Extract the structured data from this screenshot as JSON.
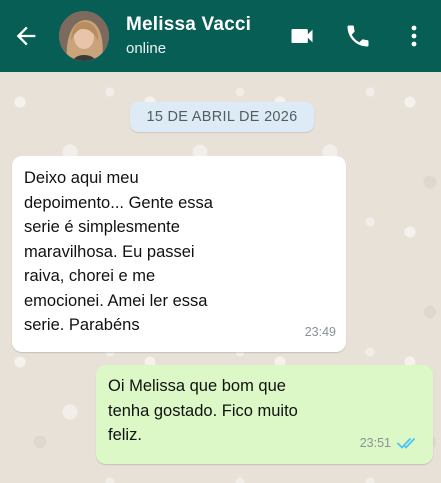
{
  "header": {
    "contact_name": "Melissa Vacci",
    "status": "online",
    "icons": [
      "back-arrow-icon",
      "video-call-icon",
      "phone-icon",
      "more-options-icon"
    ]
  },
  "chat": {
    "date_chip": "15 DE ABRIL DE 2026",
    "messages": [
      {
        "direction": "incoming",
        "text": "Deixo aqui meu\ndepoimento... Gente essa\nserie é simplesmente\nmaravilhosa. Eu passei\nraiva, chorei e me\nemocionei. Amei ler essa\nserie. Parabéns",
        "time": "23:49"
      },
      {
        "direction": "outgoing",
        "text": "Oi Melissa que bom que\ntenha gostado. Fico muito\nfeliz.",
        "time": "23:51",
        "read": true
      }
    ]
  },
  "colors": {
    "header_bg": "#075e54",
    "incoming_bg": "#ffffff",
    "outgoing_bg": "#dcf8c6",
    "read_ticks": "#4fc3f7",
    "date_chip_bg": "#dcebf5"
  }
}
